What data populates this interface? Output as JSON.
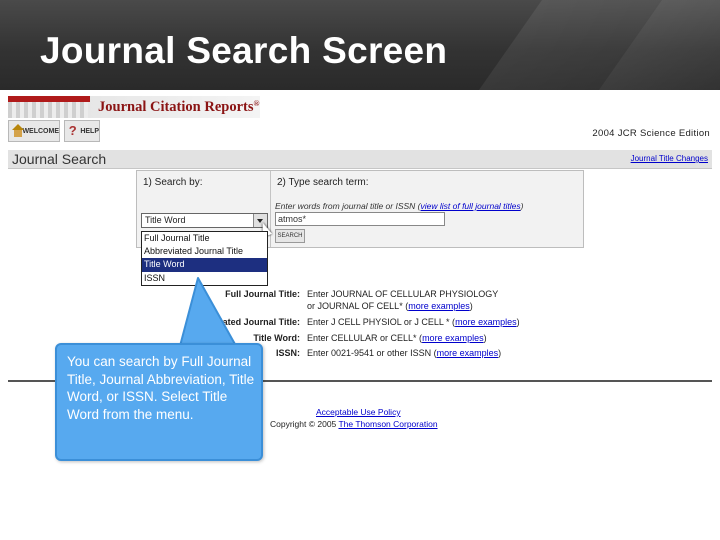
{
  "slide": {
    "title": "Journal Search Screen"
  },
  "header": {
    "logo_text": "Journal Citation Reports",
    "logo_mark": "®",
    "welcome_label": "WELCOME",
    "help_label": "HELP",
    "help_symbol": "?",
    "edition": "2004 JCR Science Edition"
  },
  "search_bar": {
    "title": "Journal Search",
    "title_changes_link": "Journal Title Changes"
  },
  "form": {
    "step1_label": "1) Search by:",
    "step2_label": "2) Type search term:",
    "hint_prefix": "Enter words from journal title or ISSN (",
    "hint_link": "view list of full journal titles",
    "hint_suffix": ")",
    "search_term_value": "atmos*",
    "search_button_label": "SEARCH",
    "select_value": "Title Word",
    "dropdown_options": [
      {
        "label": "Full Journal Title",
        "selected": false
      },
      {
        "label": "Abbreviated Journal Title",
        "selected": false
      },
      {
        "label": "Title Word",
        "selected": true
      },
      {
        "label": "ISSN",
        "selected": false
      }
    ]
  },
  "examples": [
    {
      "label": "Full Journal Title:",
      "line1": "Enter JOURNAL OF CELLULAR PHYSIOLOGY",
      "line2_prefix": "or JOURNAL OF CELL* (",
      "link": "more examples",
      "line2_suffix": ")"
    },
    {
      "label": "Abbreviated Journal Title:",
      "text_prefix": "Enter J CELL PHYSIOL or J CELL * (",
      "link": "more examples",
      "text_suffix": ")"
    },
    {
      "label": "Title Word:",
      "text_prefix": "Enter CELLULAR or CELL* (",
      "link": "more examples",
      "text_suffix": ")"
    },
    {
      "label": "ISSN:",
      "text_prefix": "Enter 0021-9541 or other ISSN (",
      "link": "more examples",
      "text_suffix": ")"
    }
  ],
  "footer": {
    "policy_link": "Acceptable Use Policy",
    "copyright_prefix": "Copyright © 2005 ",
    "copyright_link": "The Thomson Corporation"
  },
  "callout": {
    "text": "You can search by Full Journal Title, Journal Abbreviation, Title Word, or ISSN.  Select Title Word from the menu."
  },
  "colors": {
    "callout_fill": "#57a9ef",
    "selection_highlight": "#1d2f80",
    "link": "#0000cc",
    "logo_red": "#8b1414"
  }
}
